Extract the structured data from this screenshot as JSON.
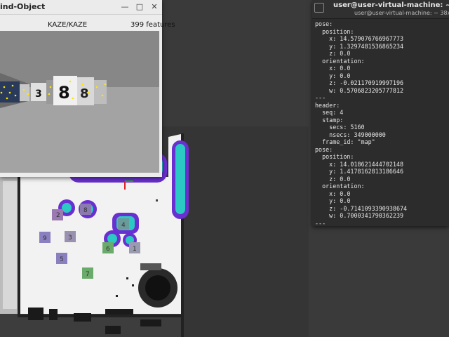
{
  "find_object": {
    "title": "ind-Object",
    "algorithm": "KAZE/KAZE",
    "features": "399 features",
    "window_buttons": [
      "minimize",
      "maximize",
      "close"
    ]
  },
  "terminal": {
    "title": "user@user-virtual-machine: ~",
    "subtitle": "user@user-virtual-machine: ~ 38x29",
    "lines": [
      "pose:",
      "  position:",
      "    x: 14.579076766967773",
      "    y: 1.3297481536865234",
      "    z: 0.0",
      "  orientation:",
      "    x: 0.0",
      "    y: 0.0",
      "    z: -0.021170919997196",
      "    w: 0.5706823205777812",
      "---",
      "header:",
      "  seq: 4",
      "  stamp:",
      "    secs: 5160",
      "    nsecs: 349000000",
      "  frame_id: \"map\"",
      "pose:",
      "  position:",
      "    x: 14.018621444702148",
      "    y: 1.4178162813186646",
      "    z: 0.0",
      "  orientation:",
      "    x: 0.0",
      "    y: 0.0",
      "    z: -0.7141093390938674",
      "    w: 0.7000341790362239",
      "---",
      "█"
    ]
  },
  "map": {
    "markers": [
      {
        "label": "2",
        "color": "#9a7ab0"
      },
      {
        "label": "8",
        "color": "#8a7ab0"
      },
      {
        "label": "9",
        "color": "#8a80c0"
      },
      {
        "label": "3",
        "color": "#9a90b0"
      },
      {
        "label": "4",
        "color": "#6a9a9a"
      },
      {
        "label": "6",
        "color": "#6aaa6a"
      },
      {
        "label": "1",
        "color": "#9a9ab0"
      },
      {
        "label": "5",
        "color": "#8a80c0"
      },
      {
        "label": "7",
        "color": "#6aaa6a"
      }
    ]
  },
  "scene": {
    "box_labels": [
      "3",
      "8",
      "8"
    ]
  }
}
